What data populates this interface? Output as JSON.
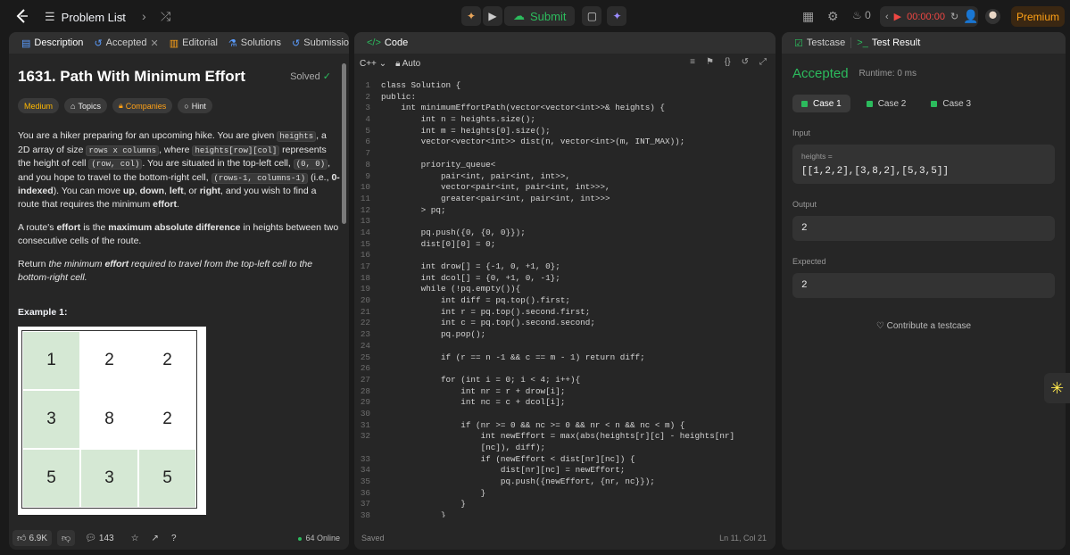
{
  "topbar": {
    "problem_list": "Problem List",
    "submit": "Submit",
    "streak": "0",
    "timer": "00:00:00",
    "premium": "Premium"
  },
  "desc": {
    "tabs": [
      "Description",
      "Accepted",
      "Editorial",
      "Solutions",
      "Submissions"
    ],
    "title": "1631. Path With Minimum Effort",
    "solved": "Solved",
    "pills": [
      "Medium",
      "Topics",
      "Companies",
      "Hint"
    ],
    "p1a": "You are a hiker preparing for an upcoming hike. You are given ",
    "heights": "heights",
    "p1b": ", a 2D array of size ",
    "size": "rows x columns",
    "p1c": ", where ",
    "hrc": "heights[row][col]",
    "p1d": " represents the height of cell ",
    "rc": "(row, col)",
    "p1e": ". You are situated in the top-left cell, ",
    "zz": "(0, 0)",
    "p1f": ", and you hope to travel to the bottom-right cell, ",
    "br": "(rows-1, columns-1)",
    "p1g": " (i.e., ",
    "idx": "0-indexed",
    "p1h": "). You can move ",
    "up": "up",
    "c1": ", ",
    "down": "down",
    "c2": ", ",
    "left": "left",
    "p1i": ", or ",
    "right": "right",
    "p1j": ", and you wish to find a route that requires the minimum ",
    "effort": "effort",
    "dot": ".",
    "p2a": "A route's ",
    "p2b": "effort",
    "p2c": " is the ",
    "p2d": "maximum absolute difference",
    "p2e": " in heights between two consecutive cells of the route.",
    "p3a": "Return ",
    "p3b": "the minimum ",
    "p3c": "effort",
    "p3d": " required to travel from the top-left cell to the bottom-right cell.",
    "example": "Example 1:",
    "grid": [
      "1",
      "2",
      "2",
      "3",
      "8",
      "2",
      "5",
      "3",
      "5"
    ],
    "likes": "6.9K",
    "comments": "143",
    "online": "64 Online"
  },
  "code": {
    "tab": "Code",
    "lang": "C++",
    "mode": "Auto",
    "saved": "Saved",
    "pos": "Ln 11, Col 21",
    "lines": [
      {
        "n": "1",
        "s": "class Solution {"
      },
      {
        "n": "2",
        "s": "public:"
      },
      {
        "n": "3",
        "s": "    int minimumEffortPath(vector<vector<int>>& heights) {"
      },
      {
        "n": "4",
        "s": "        int n = heights.size();"
      },
      {
        "n": "5",
        "s": "        int m = heights[0].size();"
      },
      {
        "n": "6",
        "s": "        vector<vector<int>> dist(n, vector<int>(m, INT_MAX));"
      },
      {
        "n": "7",
        "s": ""
      },
      {
        "n": "8",
        "s": "        priority_queue<"
      },
      {
        "n": "9",
        "s": "            pair<int, pair<int, int>>,"
      },
      {
        "n": "10",
        "s": "            vector<pair<int, pair<int, int>>>,"
      },
      {
        "n": "11",
        "s": "            greater<pair<int, pair<int, int>>>"
      },
      {
        "n": "12",
        "s": "        > pq;"
      },
      {
        "n": "13",
        "s": ""
      },
      {
        "n": "14",
        "s": "        pq.push({0, {0, 0}});"
      },
      {
        "n": "15",
        "s": "        dist[0][0] = 0;"
      },
      {
        "n": "16",
        "s": ""
      },
      {
        "n": "17",
        "s": "        int drow[] = {-1, 0, +1, 0};"
      },
      {
        "n": "18",
        "s": "        int dcol[] = {0, +1, 0, -1};"
      },
      {
        "n": "19",
        "s": "        while (!pq.empty()){"
      },
      {
        "n": "20",
        "s": "            int diff = pq.top().first;"
      },
      {
        "n": "21",
        "s": "            int r = pq.top().second.first;"
      },
      {
        "n": "22",
        "s": "            int c = pq.top().second.second;"
      },
      {
        "n": "23",
        "s": "            pq.pop();"
      },
      {
        "n": "24",
        "s": ""
      },
      {
        "n": "25",
        "s": "            if (r == n -1 && c == m - 1) return diff;"
      },
      {
        "n": "26",
        "s": ""
      },
      {
        "n": "27",
        "s": "            for (int i = 0; i < 4; i++){"
      },
      {
        "n": "28",
        "s": "                int nr = r + drow[i];"
      },
      {
        "n": "29",
        "s": "                int nc = c + dcol[i];"
      },
      {
        "n": "30",
        "s": ""
      },
      {
        "n": "31",
        "s": "                if (nr >= 0 && nc >= 0 && nr < n && nc < m) {"
      },
      {
        "n": "32",
        "s": "                    int newEffort = max(abs(heights[r][c] - heights[nr]"
      },
      {
        "n": "",
        "s": "                    [nc]), diff);"
      },
      {
        "n": "33",
        "s": "                    if (newEffort < dist[nr][nc]) {"
      },
      {
        "n": "34",
        "s": "                        dist[nr][nc] = newEffort;"
      },
      {
        "n": "35",
        "s": "                        pq.push({newEffort, {nr, nc}});"
      },
      {
        "n": "36",
        "s": "                    }"
      },
      {
        "n": "37",
        "s": "                }"
      },
      {
        "n": "38",
        "s": "            }"
      }
    ]
  },
  "test": {
    "tabs": [
      "Testcase",
      "Test Result"
    ],
    "status": "Accepted",
    "runtime": "Runtime: 0 ms",
    "cases": [
      "Case 1",
      "Case 2",
      "Case 3"
    ],
    "input_label": "Input",
    "var": "heights =",
    "input": "[[1,2,2],[3,8,2],[5,3,5]]",
    "output_label": "Output",
    "output": "2",
    "expected_label": "Expected",
    "expected": "2",
    "contribute": "Contribute a testcase"
  }
}
